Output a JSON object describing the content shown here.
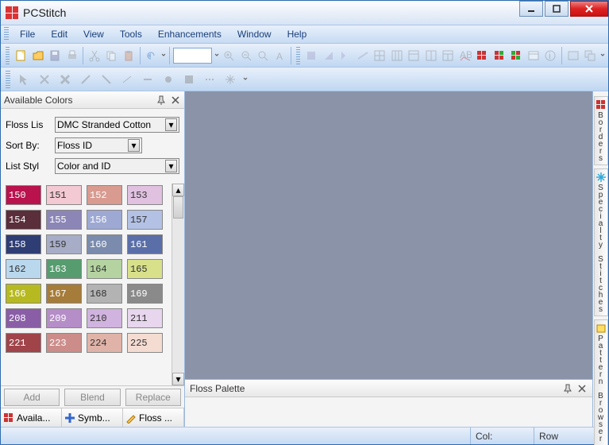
{
  "app": {
    "title": "PCStitch"
  },
  "menu": {
    "items": [
      "File",
      "Edit",
      "View",
      "Tools",
      "Enhancements",
      "Window",
      "Help"
    ]
  },
  "panel": {
    "title": "Available Colors",
    "floss_list_label": "Floss Lis",
    "floss_list_value": "DMC Stranded Cotton",
    "sort_by_label": "Sort By:",
    "sort_by_value": "Floss ID",
    "list_style_label": "List Styl",
    "list_style_value": "Color and ID",
    "btn_add": "Add",
    "btn_blend": "Blend",
    "btn_replace": "Replace",
    "tabs": [
      {
        "label": "Availa...",
        "icon": "grid"
      },
      {
        "label": "Symb...",
        "icon": "plus"
      },
      {
        "label": "Floss ...",
        "icon": "pencil"
      }
    ]
  },
  "swatches": [
    {
      "id": "150",
      "bg": "#b9124d",
      "dark": false
    },
    {
      "id": "151",
      "bg": "#f3c9d3",
      "dark": true
    },
    {
      "id": "152",
      "bg": "#d99a8f",
      "dark": false
    },
    {
      "id": "153",
      "bg": "#e0c1e0",
      "dark": true
    },
    {
      "id": "154",
      "bg": "#5a2e3a",
      "dark": false
    },
    {
      "id": "155",
      "bg": "#8c86b6",
      "dark": false
    },
    {
      "id": "156",
      "bg": "#9da9d3",
      "dark": false
    },
    {
      "id": "157",
      "bg": "#b3c1e4",
      "dark": true
    },
    {
      "id": "158",
      "bg": "#2e3d73",
      "dark": false
    },
    {
      "id": "159",
      "bg": "#a7adc7",
      "dark": true
    },
    {
      "id": "160",
      "bg": "#7a8bad",
      "dark": false
    },
    {
      "id": "161",
      "bg": "#5a6fa8",
      "dark": false
    },
    {
      "id": "162",
      "bg": "#b9d8ee",
      "dark": true
    },
    {
      "id": "163",
      "bg": "#569c6f",
      "dark": false
    },
    {
      "id": "164",
      "bg": "#b4d3a1",
      "dark": true
    },
    {
      "id": "165",
      "bg": "#d8e18a",
      "dark": true
    },
    {
      "id": "166",
      "bg": "#b6b91f",
      "dark": false
    },
    {
      "id": "167",
      "bg": "#a57c3a",
      "dark": false
    },
    {
      "id": "168",
      "bg": "#b3b3b3",
      "dark": true
    },
    {
      "id": "169",
      "bg": "#8a8a8a",
      "dark": false
    },
    {
      "id": "208",
      "bg": "#8a5ea6",
      "dark": false
    },
    {
      "id": "209",
      "bg": "#b58dc7",
      "dark": false
    },
    {
      "id": "210",
      "bg": "#d0b3de",
      "dark": true
    },
    {
      "id": "211",
      "bg": "#e7d6ed",
      "dark": true
    },
    {
      "id": "221",
      "bg": "#a0444a",
      "dark": false
    },
    {
      "id": "223",
      "bg": "#cc8d8a",
      "dark": false
    },
    {
      "id": "224",
      "bg": "#e0b3a8",
      "dark": true
    },
    {
      "id": "225",
      "bg": "#f4dcd2",
      "dark": true
    }
  ],
  "center": {
    "palette_title": "Floss Palette"
  },
  "right_tabs": [
    "Borders",
    "Specialty Stitches",
    "Pattern Browser"
  ],
  "status": {
    "col": "Col:",
    "row": "Row"
  }
}
